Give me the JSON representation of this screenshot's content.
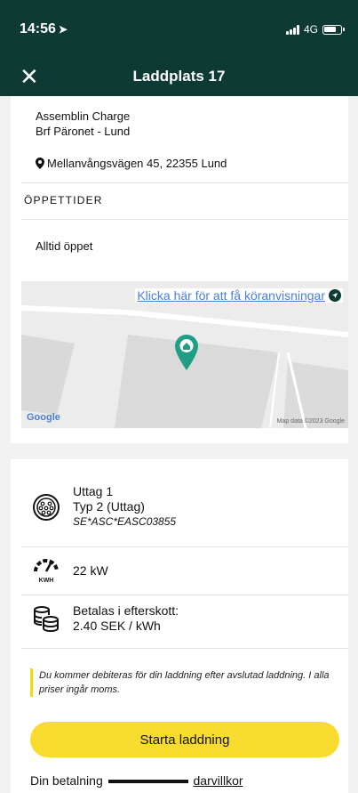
{
  "status_bar": {
    "time": "14:56",
    "network": "4G"
  },
  "header": {
    "title": "Laddplats 17",
    "close_icon": "close-icon"
  },
  "station": {
    "operator": "Assemblin Charge",
    "site": "Brf Päronet - Lund",
    "address": "Mellanvångsvägen 45, 22355 Lund"
  },
  "hours": {
    "heading": "ÖPPETTIDER",
    "value": "Alltid öppet"
  },
  "map": {
    "directions_link": "Klicka här för att få köranvisningar",
    "provider": "Google",
    "attribution": "Map data ©2023 Google"
  },
  "connector": {
    "name": "Uttag 1",
    "type": "Typ 2 (Uttag)",
    "code": "SE*ASC*EASC03855",
    "power": "22 kW",
    "power_unit": "KWH",
    "payment_label": "Betalas i efterskott:",
    "price": "2.40 SEK / kWh"
  },
  "notice": "Du kommer debiteras för din laddning efter avslutad laddning. I alla priser ingår moms.",
  "actions": {
    "start_label": "Starta laddning"
  },
  "terms": {
    "prefix": "Din betalning",
    "link": "darvillkor"
  },
  "colors": {
    "brand": "#0d3b34",
    "accent": "#f7dc2f",
    "link": "#4a7fd4",
    "pin": "#1f9e85"
  }
}
